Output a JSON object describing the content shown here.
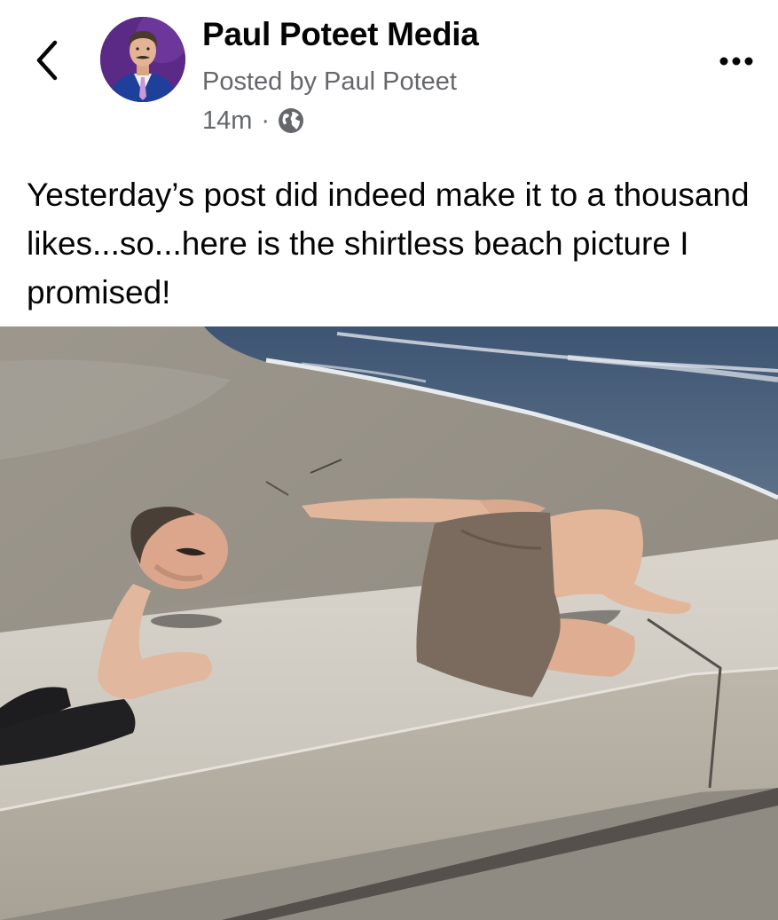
{
  "header": {
    "page_name": "Paul Poteet Media",
    "posted_by": "Posted by Paul Poteet",
    "time": "14m",
    "separator": "·",
    "audience_icon": "globe-icon",
    "back_icon": "chevron-left-icon",
    "more_icon": "more-horizontal-icon"
  },
  "post": {
    "text": "Yesterday’s post did indeed make it to a thousand likes...so...here is the shirtless beach picture I promised!"
  },
  "colors": {
    "primary_text": "#050505",
    "secondary_text": "#65676b",
    "avatar_background": "#5a2d82"
  }
}
